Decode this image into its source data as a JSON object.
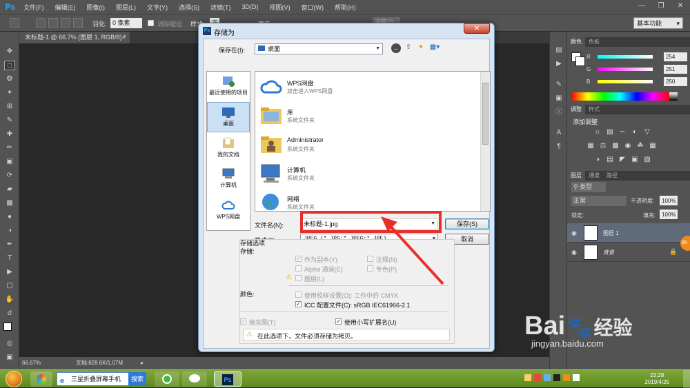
{
  "menubar": {
    "logo": "Ps",
    "items": [
      "文件(F)",
      "编辑(E)",
      "图像(I)",
      "图层(L)",
      "文字(Y)",
      "选择(S)",
      "滤镜(T)",
      "3D(D)",
      "视图(V)",
      "窗口(W)",
      "帮助(H)"
    ]
  },
  "optionsbar": {
    "feather_label": "羽化:",
    "feather_value": "0 像素",
    "antialias_label": "消除锯齿",
    "style_label": "样式:",
    "style_value": "正常",
    "width_label": "宽度:",
    "refine_label": "调整边缘...",
    "workspace": "基本功能"
  },
  "document_tab": "未标题-1 @ 66.7% (图层 1, RGB/8) *",
  "statusbar": {
    "zoom": "66.67%",
    "doc_info": "文档:828.6K/1.07M"
  },
  "panels": {
    "color_tabs": [
      "颜色",
      "色板"
    ],
    "r_label": "R",
    "g_label": "G",
    "b_label": "B",
    "r_value": "254",
    "g_value": "251",
    "b_value": "250",
    "adjust_tabs": [
      "调整",
      "样式"
    ],
    "adjust_title": "添加调整",
    "layers_tabs": [
      "图层",
      "通道",
      "路径"
    ],
    "filter_kind": "类型",
    "blend_mode": "正常",
    "opacity_label": "不透明度:",
    "opacity_value": "100%",
    "lock_label": "锁定:",
    "fill_label": "填充:",
    "fill_value": "100%",
    "layers": [
      {
        "name": "图层 1"
      },
      {
        "name": "背景"
      }
    ]
  },
  "dialog": {
    "title": "存储为",
    "save_in_label": "保存在(I):",
    "save_in_value": "桌面",
    "places": [
      {
        "label": "最近使用的项目"
      },
      {
        "label": "桌面"
      },
      {
        "label": "我的文档"
      },
      {
        "label": "计算机"
      },
      {
        "label": "WPS网盘"
      }
    ],
    "files": [
      {
        "name": "WPS网盘",
        "desc": "双击进入WPS网盘"
      },
      {
        "name": "库",
        "desc": "系统文件夹"
      },
      {
        "name": "Administrator",
        "desc": "系统文件夹"
      },
      {
        "name": "计算机",
        "desc": "系统文件夹"
      },
      {
        "name": "网络",
        "desc": "系统文件夹"
      }
    ],
    "filename_label": "文件名(N):",
    "filename_value": "未标题-1.jpg",
    "format_label": "格式(F):",
    "format_value": "JPEG (*.JPG;*.JPEG;*.JPE)",
    "save_button": "保存(S)",
    "cancel_button": "取消",
    "save_options_title": "存储选项",
    "save_label": "存储:",
    "as_copy": "作为副本(Y)",
    "notes": "注释(N)",
    "alpha": "Alpha 通道(E)",
    "spot": "专色(P)",
    "layers_opt": "图层(L)",
    "color_label": "颜色:",
    "use_proof": "使用校样设置(O): 工作中的 CMYK",
    "icc_profile": "ICC 配置文件(C): sRGB IEC61966-2.1",
    "thumbnail": "缩览图(T)",
    "lowercase_ext": "使用小写扩展名(U)",
    "warning": "在此选项下，文件必须存储为拷贝。"
  },
  "taskbar": {
    "search_placeholder": "三星折叠屏幕手机",
    "search_button": "搜索",
    "ps_label": "Ps",
    "time": "23:28",
    "date": "2019/4/25"
  },
  "watermark": {
    "brand": "Bai",
    "brand_cn": "经验",
    "url": "jingyan.baidu.com"
  }
}
